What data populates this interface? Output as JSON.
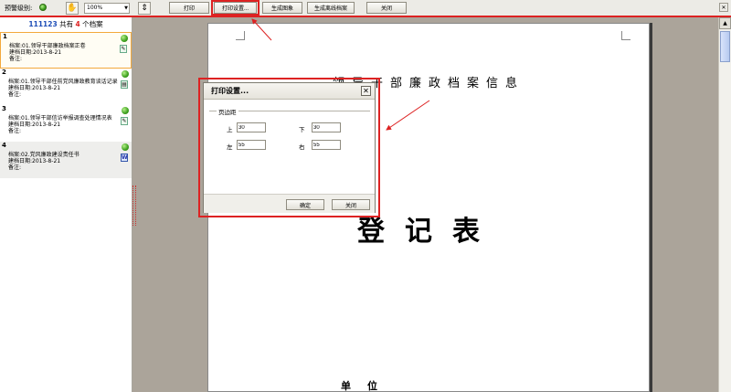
{
  "toolbar": {
    "warning_label": "预警级别:",
    "zoom_value": "100%",
    "print_label": "打印",
    "print_settings_label": "打印设置...",
    "gen_image_label": "生成图象",
    "gen_offline_label": "生成离线档案",
    "close_label": "关闭"
  },
  "sidebar": {
    "header_id": "111123",
    "header_prefix": "共有",
    "header_count": "4",
    "header_suffix": "个档案",
    "items": [
      {
        "index": "1",
        "line1": "档案:01.领导干部廉政档案正卷",
        "line2": "建档日期:2013-8-21",
        "line3": "备注:"
      },
      {
        "index": "2",
        "line1": "档案:01.领导干部任前党风廉政教育谈话记录",
        "line2": "建档日期:2013-8-21",
        "line3": "备注:"
      },
      {
        "index": "3",
        "line1": "档案:01.领导干部信访举报调查处理情况表",
        "line2": "建档日期:2013-8-21",
        "line3": "备注:"
      },
      {
        "index": "4",
        "line1": "档案:02.党风廉政建设责任书",
        "line2": "建档日期:2013-8-21",
        "line3": "备注:"
      }
    ]
  },
  "document": {
    "title": "领导干部廉政档案信息",
    "big_title": "登记表",
    "unit_label": "单位"
  },
  "dialog": {
    "title": "打印设置...",
    "close_glyph": "✕",
    "group_label": "页边距",
    "top_label": "上",
    "top_value": "30",
    "bottom_label": "下",
    "bottom_value": "30",
    "left_label": "左",
    "left_value": "55",
    "right_label": "右",
    "right_value": "55",
    "ok_label": "确定",
    "cancel_label": "关闭"
  },
  "colors": {
    "highlight": "#dd2222",
    "status_green": "#3ca01e",
    "count_red": "#dd2222",
    "id_blue": "#1f4fb8"
  },
  "icons": [
    "status-green-icon",
    "hand-icon",
    "fit-page-icon",
    "document-icon",
    "word-icon",
    "close-icon",
    "scroll-up-icon"
  ]
}
